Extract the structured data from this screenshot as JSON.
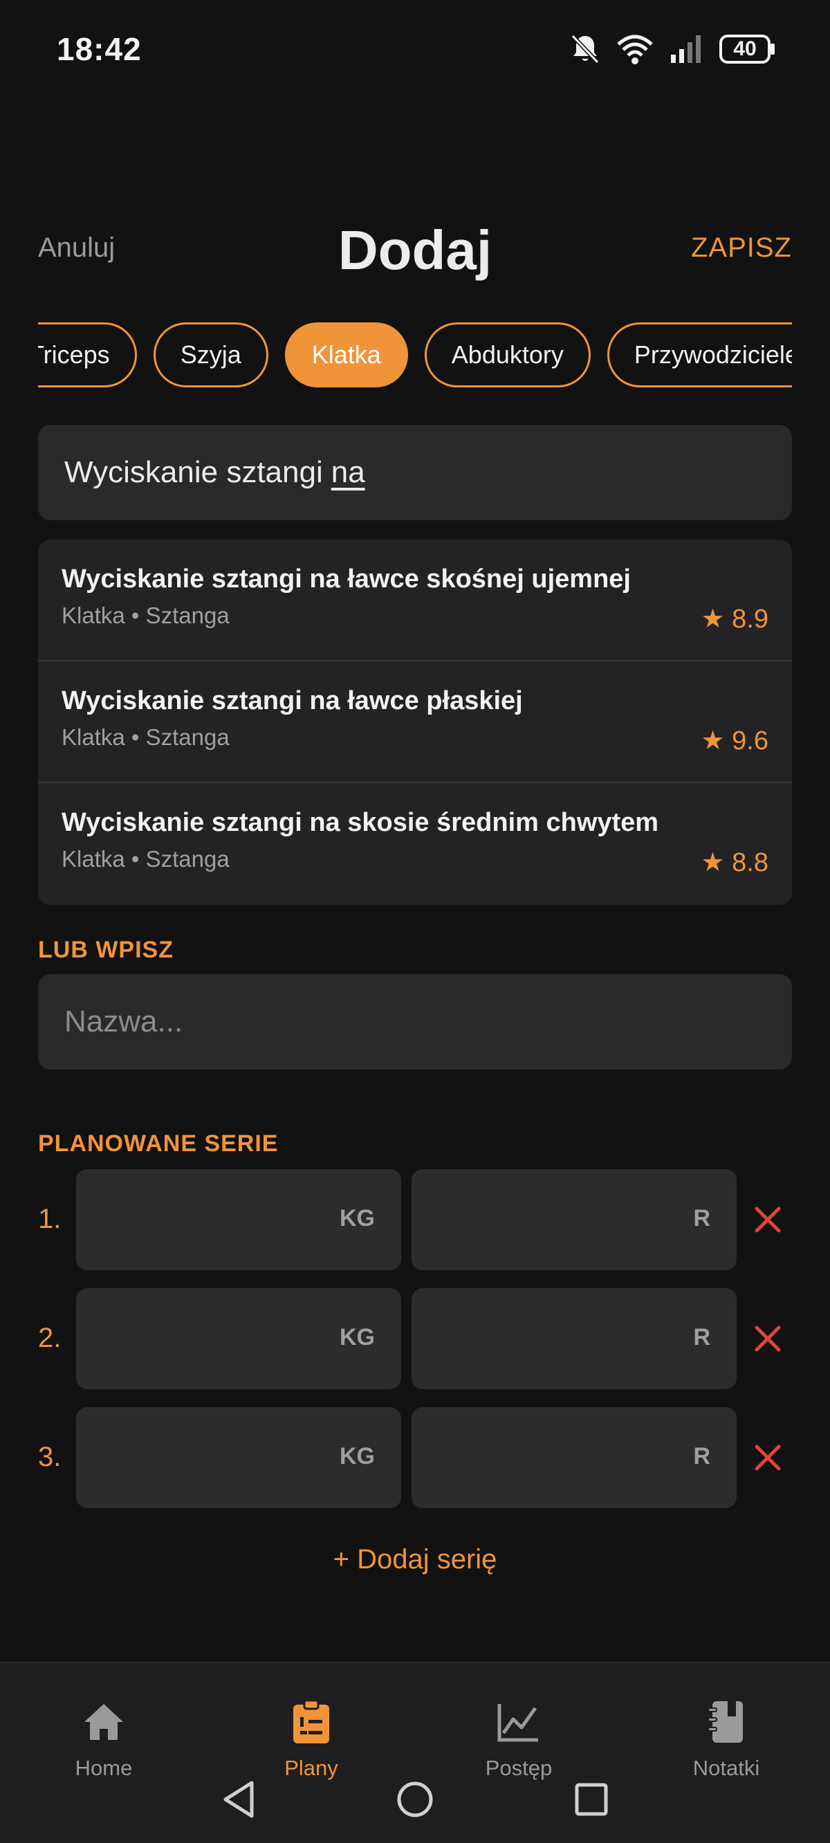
{
  "status_bar": {
    "time": "18:42",
    "battery": "40",
    "icons": [
      "bell-muted-icon",
      "wifi-icon",
      "signal-icon",
      "battery-icon"
    ]
  },
  "header": {
    "cancel_label": "Anuluj",
    "title": "Dodaj",
    "save_label": "ZAPISZ"
  },
  "categories": {
    "items": [
      "Triceps",
      "Szyja",
      "Klatka",
      "Abduktory",
      "Przywodziciele"
    ],
    "selected": "Klatka"
  },
  "search": {
    "value_plain": "Wyciskanie sztangi",
    "value_underlined": "na"
  },
  "results": [
    {
      "name": "Wyciskanie sztangi na ławce skośnej ujemnej",
      "meta": "Klatka • Sztanga",
      "rating": "★ 8.9"
    },
    {
      "name": "Wyciskanie sztangi na ławce płaskiej",
      "meta": "Klatka • Sztanga",
      "rating": "★ 9.6"
    },
    {
      "name": "Wyciskanie sztangi na skosie średnim chwytem",
      "meta": "Klatka • Sztanga",
      "rating": "★ 8.8"
    }
  ],
  "custom": {
    "label": "LUB WPISZ",
    "placeholder": "Nazwa..."
  },
  "sets": {
    "label": "PLANOWANE SERIE",
    "rows": [
      {
        "num": "1.",
        "kg_unit": "KG",
        "reps_unit": "R"
      },
      {
        "num": "2.",
        "kg_unit": "KG",
        "reps_unit": "R"
      },
      {
        "num": "3.",
        "kg_unit": "KG",
        "reps_unit": "R"
      }
    ],
    "add_label": "+ Dodaj serię"
  },
  "bottom_nav": [
    {
      "label": "Home",
      "icon": "home-icon",
      "active": false
    },
    {
      "label": "Plany",
      "icon": "clipboard-list-icon",
      "active": true
    },
    {
      "label": "Postęp",
      "icon": "chart-line-icon",
      "active": false
    },
    {
      "label": "Notatki",
      "icon": "notebook-icon",
      "active": false
    }
  ],
  "colors": {
    "accent": "#f0943a",
    "background": "#121212",
    "surface": "#2a2a2c",
    "delete": "#e0453a"
  }
}
